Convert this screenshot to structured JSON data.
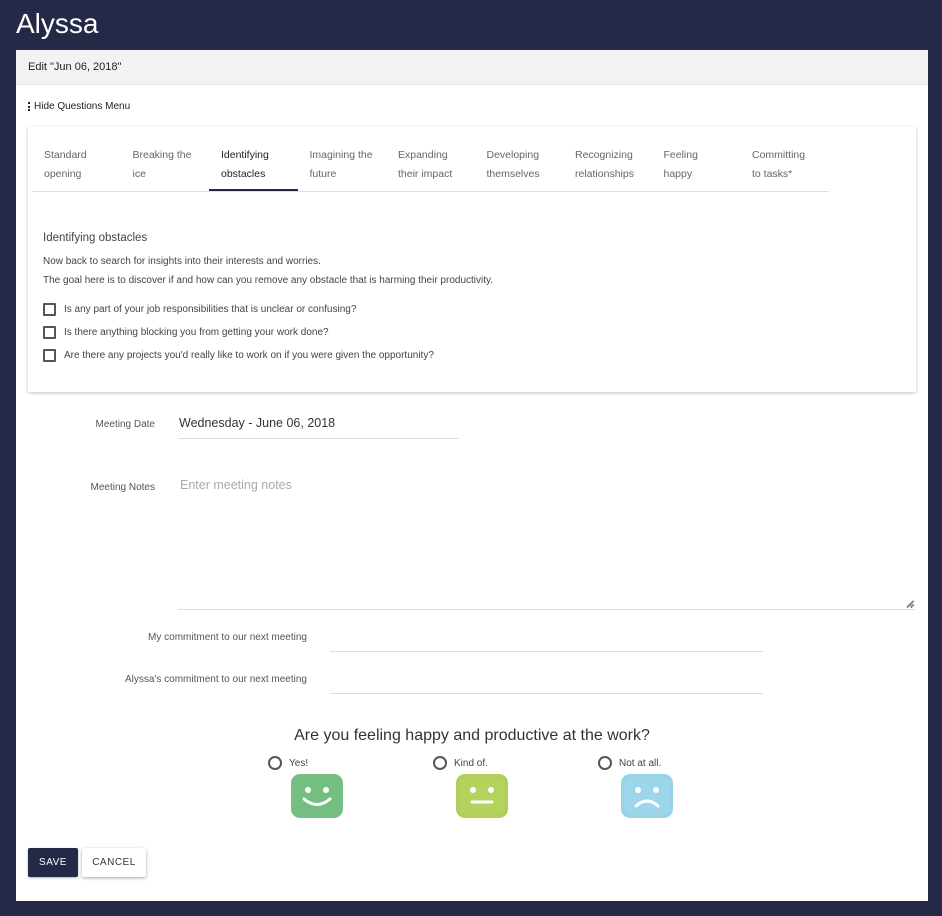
{
  "page": {
    "title": "Alyssa"
  },
  "card": {
    "header": "Edit \"Jun 06, 2018\""
  },
  "menu_toggle": {
    "label": "Hide Questions Menu"
  },
  "tabs": [
    {
      "line1": "Standard",
      "line2": "opening"
    },
    {
      "line1": "Breaking the",
      "line2": "ice"
    },
    {
      "line1": "Identifying",
      "line2": "obstacles"
    },
    {
      "line1": "Imagining the",
      "line2": "future"
    },
    {
      "line1": "Expanding",
      "line2": "their impact"
    },
    {
      "line1": "Developing",
      "line2": "themselves"
    },
    {
      "line1": "Recognizing",
      "line2": "relationships"
    },
    {
      "line1": "Feeling",
      "line2": "happy"
    },
    {
      "line1": "Committing",
      "line2": "to tasks*"
    }
  ],
  "section": {
    "title": "Identifying obstacles",
    "desc1": "Now back to search for insights into their interests and worries.",
    "desc2": "The goal here is to discover if and how can you remove any obstacle that is harming their productivity.",
    "questions": [
      "Is any part of your job responsibilities that is unclear or confusing?",
      "Is there anything blocking you from getting your work done?",
      "Are there any projects you'd really like to work on if you were given the opportunity?"
    ]
  },
  "form": {
    "meeting_date_label": "Meeting Date",
    "meeting_date_value": "Wednesday - June 06, 2018",
    "meeting_notes_label": "Meeting Notes",
    "meeting_notes_placeholder": "Enter meeting notes",
    "my_commitment_label": "My commitment to our next meeting",
    "their_commitment_label": "Alyssa's commitment to our next meeting"
  },
  "happiness": {
    "question": "Are you feeling happy and productive at the work?",
    "options": [
      {
        "label": "Yes!",
        "icon": "happy-face-icon",
        "color": "#5fb36f"
      },
      {
        "label": "Kind of.",
        "icon": "neutral-face-icon",
        "color": "#a6c94a"
      },
      {
        "label": "Not at all.",
        "icon": "sad-face-icon",
        "color": "#8ccde6"
      }
    ]
  },
  "buttons": {
    "save": "SAVE",
    "cancel": "CANCEL"
  },
  "colors": {
    "primary": "#232946",
    "background": "#232946"
  }
}
